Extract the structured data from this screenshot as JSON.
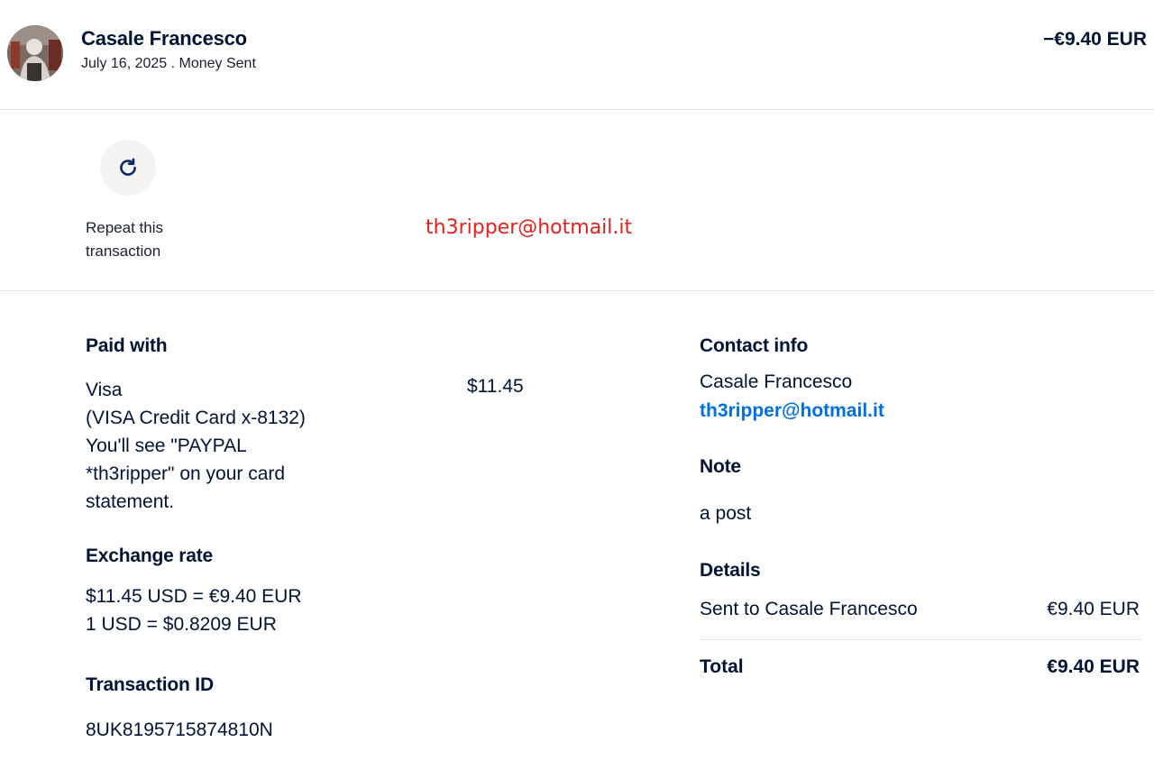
{
  "header": {
    "name": "Casale Francesco",
    "subtitle": "July 16, 2025 . Money Sent",
    "amount": "−€9.40 EUR",
    "avatar_icon": "profile-photo"
  },
  "repeat": {
    "icon": "refresh-icon",
    "label": "Repeat this transaction"
  },
  "overlay": {
    "email": "th3ripper@hotmail.it",
    "color": "#e3201b"
  },
  "paid_with": {
    "title": "Paid with",
    "method": "Visa",
    "lines": [
      "(VISA Credit Card x-8132)",
      "You'll see \"PAYPAL",
      "*th3ripper\" on your card",
      "statement."
    ],
    "amount": "$11.45"
  },
  "exchange_rate": {
    "title": "Exchange rate",
    "line1": "$11.45 USD = €9.40 EUR",
    "line2": "1 USD = $0.8209 EUR"
  },
  "transaction": {
    "title": "Transaction ID",
    "id": "8UK8195715874810N"
  },
  "contact": {
    "title": "Contact info",
    "name": "Casale Francesco",
    "email": "th3ripper@hotmail.it",
    "email_color": "#0070e0"
  },
  "note": {
    "title": "Note",
    "value": "a post"
  },
  "details": {
    "title": "Details",
    "sent_label": "Sent to Casale Francesco",
    "sent_value": "€9.40 EUR",
    "total_label": "Total",
    "total_value": "€9.40 EUR"
  }
}
